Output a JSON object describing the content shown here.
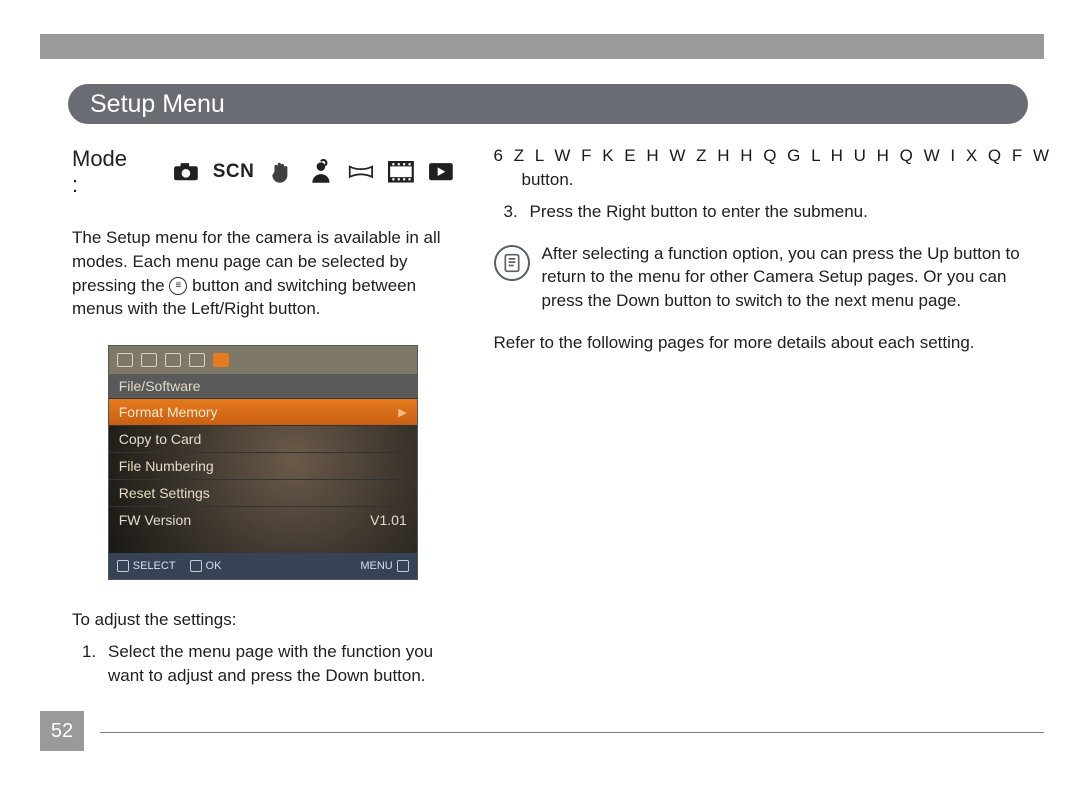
{
  "tab": {
    "title": "Setup Menu"
  },
  "mode": {
    "label": "Mode :",
    "scn": "SCN"
  },
  "left": {
    "intro_a": "The Setup menu for the camera is available in all modes. Each menu page can be selected by pressing the ",
    "intro_b": " button and switching between menus with the Left/Right button.",
    "toAdjust": "To adjust the settings:",
    "step1_num": "1.",
    "step1": "Select the menu page with the function you want to adjust and press the Down button."
  },
  "screenshot": {
    "header": "File/Software",
    "rows": [
      {
        "label": "Format Memory",
        "highlight": true,
        "arrow": true
      },
      {
        "label": "Copy to Card",
        "highlight": false
      },
      {
        "label": "File Numbering",
        "highlight": false
      },
      {
        "label": "Reset Settings",
        "highlight": false
      },
      {
        "label": "FW Version",
        "highlight": false,
        "value": "V1.01"
      }
    ],
    "bottom": {
      "select": "SELECT",
      "ok": "OK",
      "menu": "MENU"
    }
  },
  "right": {
    "garble": "6 Z L W F K   E H W Z H H Q   G L   H U H Q W   I X Q F W",
    "step2_tail": "button.",
    "step3_num": "3.",
    "step3_a": "Press the ",
    "step3_right": "Right",
    "step3_b": " button to enter the submenu.",
    "note": "After selecting a function option, you can press the Up button to return to the menu for other Camera Setup pages. Or you can press the Down button to switch to the next menu page.",
    "refer": "Refer to the following pages for more details about each setting."
  },
  "pageNumber": "52"
}
